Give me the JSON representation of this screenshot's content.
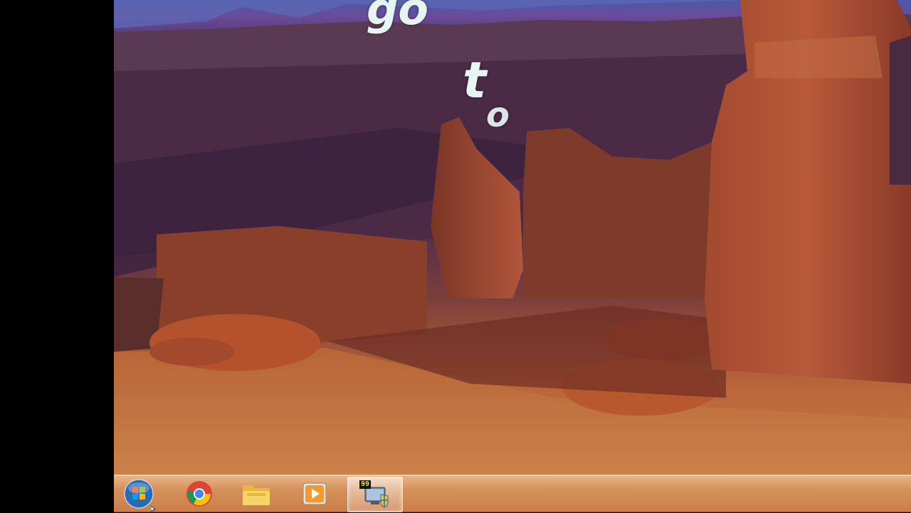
{
  "overlay_text": {
    "letters_top": "go",
    "letter_t": "t",
    "letter_o": "o"
  },
  "taskbar": {
    "items": [
      {
        "name": "start",
        "icon": "windows-orb-icon"
      },
      {
        "name": "chrome",
        "icon": "chrome-icon"
      },
      {
        "name": "explorer",
        "icon": "folder-icon"
      },
      {
        "name": "media-player",
        "icon": "media-player-icon"
      },
      {
        "name": "active-app",
        "icon": "computer-shield-icon",
        "badge": "99"
      }
    ]
  },
  "colors": {
    "sky": "#4a5aa8",
    "rock": "#b8653a",
    "taskbar": "#d9a070",
    "overlay_text": "#e6f4f2"
  }
}
